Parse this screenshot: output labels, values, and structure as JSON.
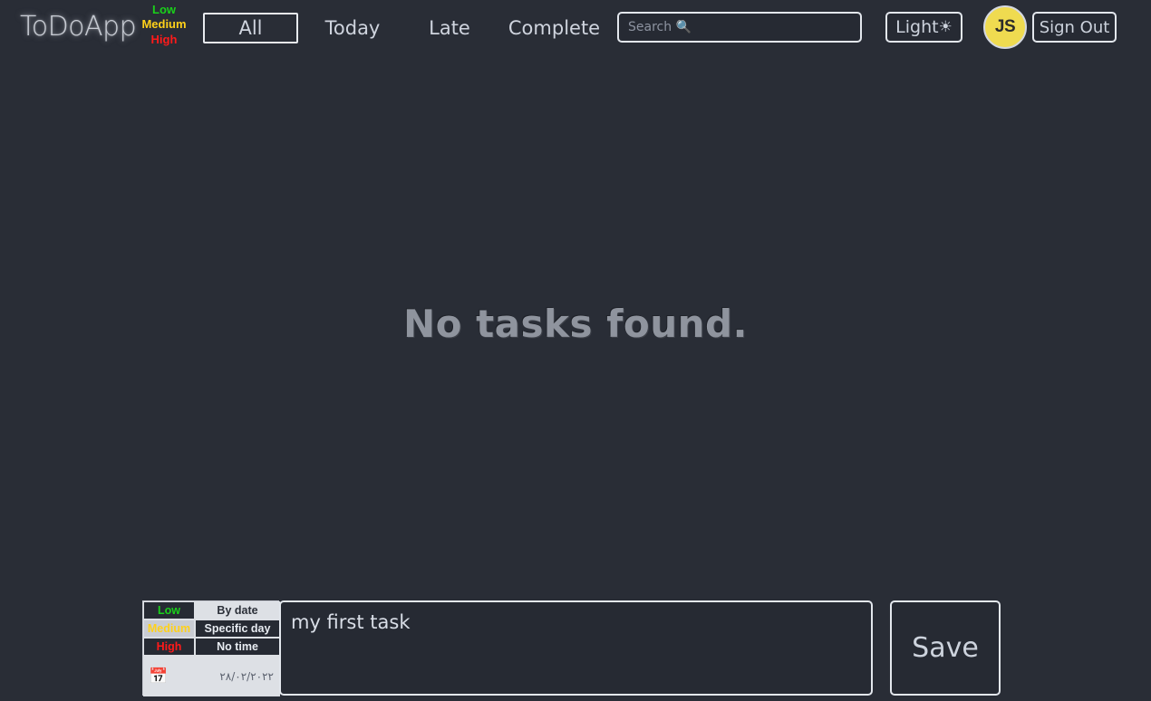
{
  "header": {
    "brand": "ToDoApp",
    "priority_legend": [
      {
        "label": "Low",
        "color": "#1ad01a"
      },
      {
        "label": "Medium",
        "color": "#ffd11a"
      },
      {
        "label": "High",
        "color": "#ff1a1a"
      }
    ],
    "tabs": [
      {
        "label": "All",
        "active": true
      },
      {
        "label": "Today",
        "active": false
      },
      {
        "label": "Late",
        "active": false
      },
      {
        "label": "Complete",
        "active": false
      }
    ],
    "search": {
      "value": "",
      "placeholder": "Search 🔍",
      "icon": "search-icon"
    },
    "theme_toggle": {
      "label": "Light",
      "icon": "☀"
    },
    "avatar": {
      "initials": "JS",
      "background": "#efdb50"
    },
    "sign_out": "Sign Out"
  },
  "main": {
    "empty_state": "No tasks found."
  },
  "composer": {
    "priority_options": [
      {
        "label": "Low",
        "color": "#1ad01a",
        "selected": false
      },
      {
        "label": "Medium",
        "color": "#ffd11a",
        "selected": true
      },
      {
        "label": "High",
        "color": "#ff1a1a",
        "selected": false
      }
    ],
    "date_options": [
      {
        "label": "By date",
        "color": "#2b2f38",
        "selected": true
      },
      {
        "label": "Specific day",
        "color": "#e8ecf2",
        "selected": false
      },
      {
        "label": "No time",
        "color": "#e8ecf2",
        "selected": false
      }
    ],
    "date_field": {
      "icon": "calendar-icon",
      "value": "٢٨/٠٢/٢٠٢٢"
    },
    "task_text": "my first task",
    "task_placeholder": "",
    "save_label": "Save"
  },
  "colors": {
    "background": "#292d36",
    "panel": "#dde0e5",
    "border": "#e3e7ed",
    "text": "#d8dde6",
    "muted": "#8f949e"
  }
}
